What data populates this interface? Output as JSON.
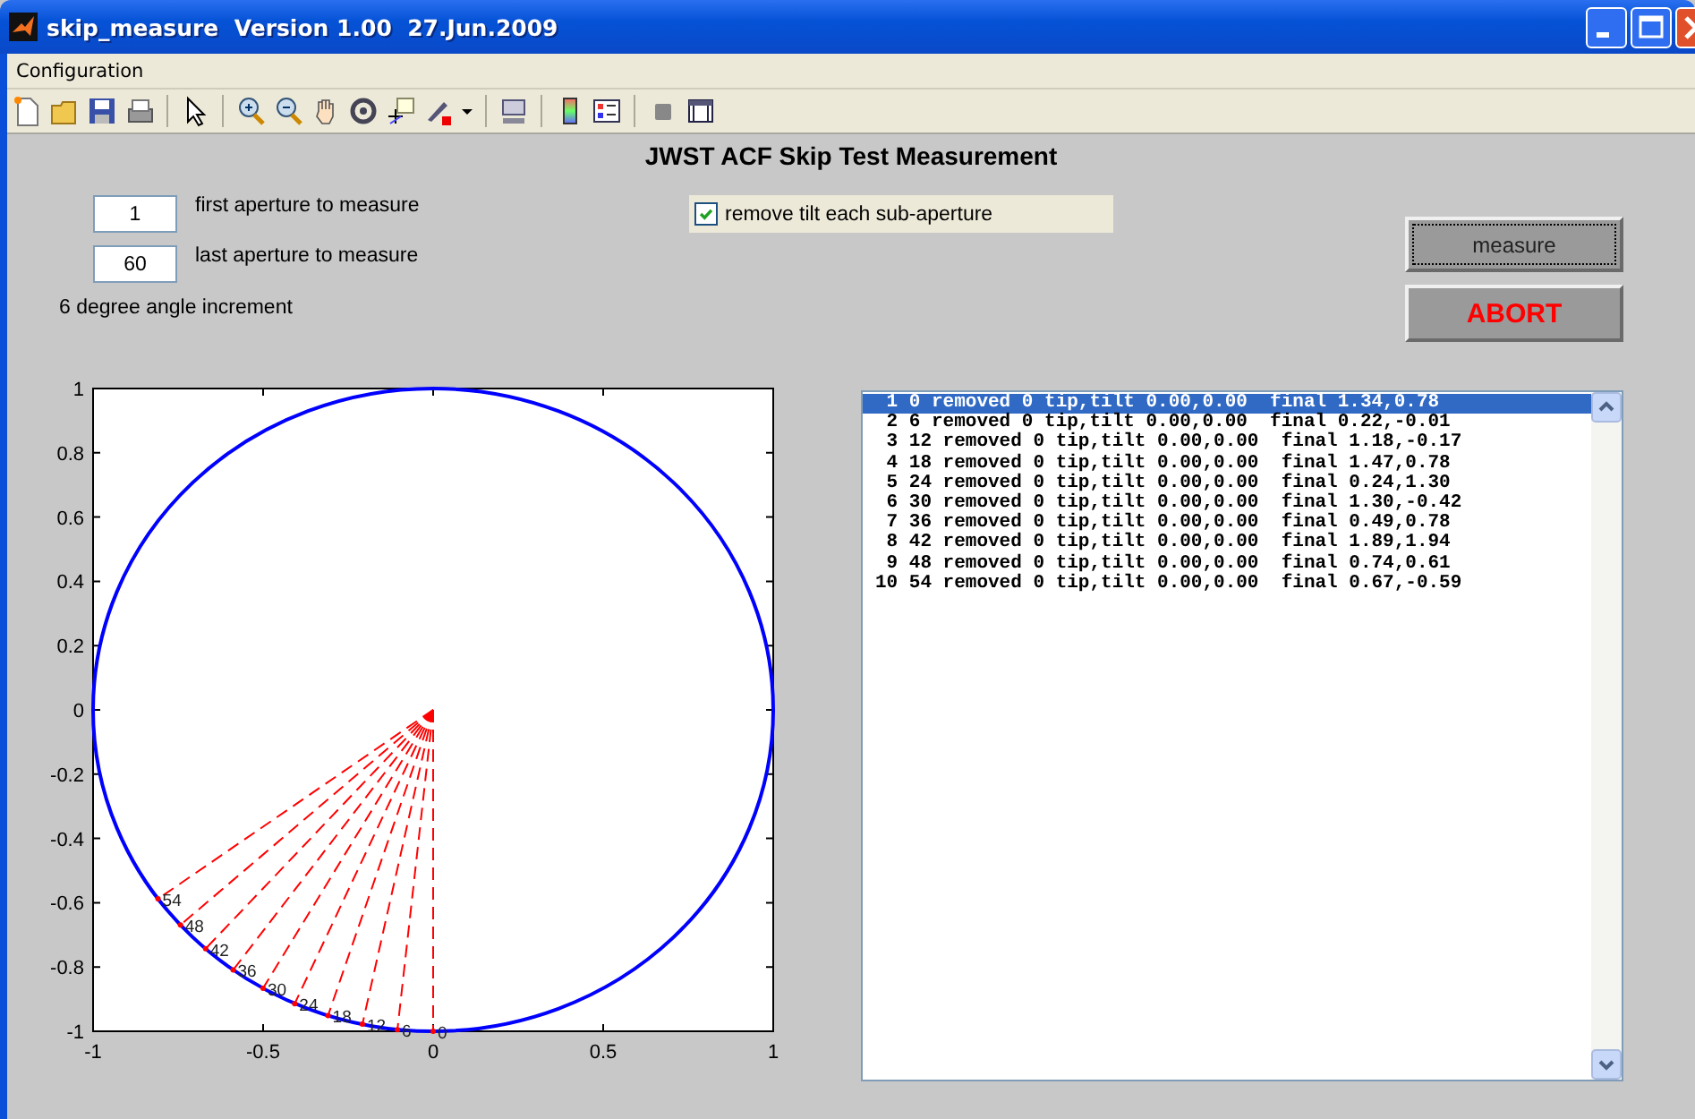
{
  "window": {
    "title": "skip_measure  Version 1.00  27.Jun.2009"
  },
  "menu": [
    {
      "label": "Configuration"
    }
  ],
  "heading": "JWST ACF Skip Test Measurement",
  "fields": [
    {
      "value": "1",
      "label": "first aperture to measure"
    },
    {
      "value": "60",
      "label": "last aperture to measure"
    }
  ],
  "increment": "6 degree angle increment",
  "checkbox": {
    "label": "remove tilt each sub-aperture",
    "checked": true
  },
  "buttons": [
    {
      "label": "measure",
      "kind": "normal"
    },
    {
      "label": "ABORT",
      "kind": "alert"
    }
  ],
  "plot": {
    "chart_data": {
      "type": "scatter",
      "xlim": [
        -1,
        1
      ],
      "ylim": [
        -1,
        1
      ],
      "xticks": [
        -1,
        -0.5,
        0,
        0.5,
        1
      ],
      "yticks": [
        -1,
        -0.8,
        -0.6,
        -0.4,
        -0.2,
        0,
        0.2,
        0.4,
        0.6,
        0.8,
        1
      ],
      "x": [
        0,
        -0.105,
        -0.208,
        -0.309,
        -0.407,
        -0.5,
        -0.588,
        -0.669,
        -0.743,
        -0.809
      ],
      "series": [
        {
          "color": "#ff0000",
          "values": [
            -1,
            -0.995,
            -0.978,
            -0.951,
            -0.914,
            -0.866,
            -0.809,
            -0.743,
            -0.669,
            -0.588
          ]
        }
      ],
      "annotations": [
        "0",
        "6",
        "12",
        "18",
        "24",
        "30",
        "36",
        "42",
        "48",
        "54"
      ]
    }
  },
  "list": {
    "rows": [
      {
        "text": " 1 0 removed 0 tip,tilt 0.00,0.00  final 1.34,0.78",
        "selected": true
      },
      {
        "text": " 2 6 removed 0 tip,tilt 0.00,0.00  final 0.22,-0.01",
        "selected": false
      },
      {
        "text": " 3 12 removed 0 tip,tilt 0.00,0.00  final 1.18,-0.17",
        "selected": false
      },
      {
        "text": " 4 18 removed 0 tip,tilt 0.00,0.00  final 1.47,0.78",
        "selected": false
      },
      {
        "text": " 5 24 removed 0 tip,tilt 0.00,0.00  final 0.24,1.30",
        "selected": false
      },
      {
        "text": " 6 30 removed 0 tip,tilt 0.00,0.00  final 1.30,-0.42",
        "selected": false
      },
      {
        "text": " 7 36 removed 0 tip,tilt 0.00,0.00  final 0.49,0.78",
        "selected": false
      },
      {
        "text": " 8 42 removed 0 tip,tilt 0.00,0.00  final 1.89,1.94",
        "selected": false
      },
      {
        "text": " 9 48 removed 0 tip,tilt 0.00,0.00  final 0.74,0.61",
        "selected": false
      },
      {
        "text": "10 54 removed 0 tip,tilt 0.00,0.00  final 0.67,-0.59",
        "selected": false
      }
    ]
  }
}
